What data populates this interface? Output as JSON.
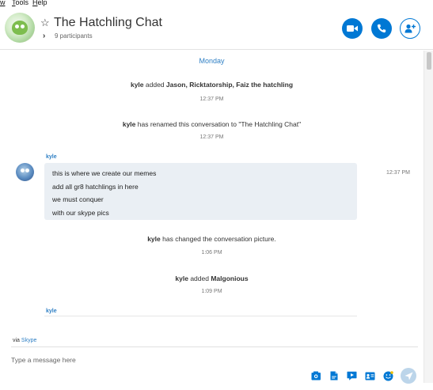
{
  "menu": {
    "items": [
      "w",
      "Tools",
      "Help"
    ]
  },
  "header": {
    "title": "The Hatchling Chat",
    "participants": "9 participants",
    "accent": "#0078d4"
  },
  "chat": {
    "day": "Monday",
    "events": [
      {
        "user": "kyle",
        "text": "added",
        "targets": "Jason, Ricktatorship, Faiz the hatchling",
        "time": "12:37 PM"
      },
      {
        "user": "kyle",
        "text": "has renamed this conversation to \"The Hatchling Chat\"",
        "time": "12:37 PM"
      },
      {
        "user": "kyle",
        "text": "has changed the conversation picture.",
        "time": "1:06 PM"
      },
      {
        "user": "kyle",
        "text": "added",
        "targets": "Malgonious",
        "time": "1:09 PM"
      }
    ],
    "message": {
      "sender": "kyle",
      "lines": [
        "this is where we create our memes",
        "add all gr8 hatchlings in here",
        "we must conquer",
        "with our skype pics"
      ],
      "time": "12:37 PM"
    },
    "partial_sender": "kyle"
  },
  "compose": {
    "via_prefix": "via",
    "via_link": "Skype",
    "placeholder": "Type a message here"
  }
}
